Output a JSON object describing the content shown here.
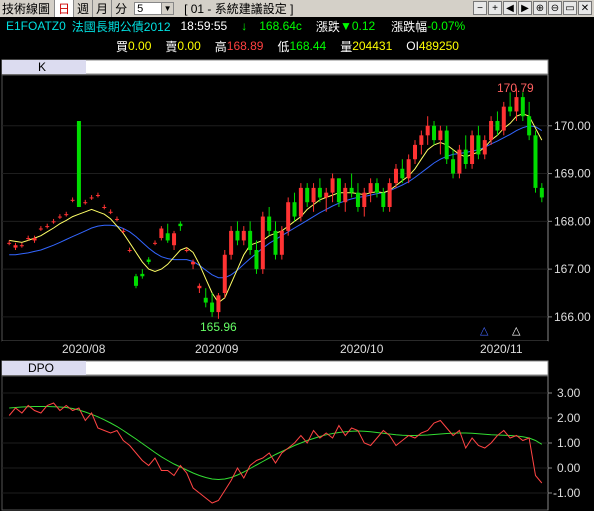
{
  "toolbar": {
    "title": "技術線圖",
    "periods": [
      "日",
      "週",
      "月",
      "分"
    ],
    "active_period": "日",
    "minute_value": "5",
    "setting_label": "[ 01 - 系統建議設定 ]",
    "tool_icons": [
      "minus-icon",
      "plus-icon",
      "left-arrow-icon",
      "right-arrow-icon",
      "zoom-in-icon",
      "zoom-out-icon",
      "window-icon",
      "close-icon"
    ],
    "tool_glyphs": [
      "−",
      "+",
      "◀",
      "▶",
      "⊕",
      "⊖",
      "▭",
      "✕"
    ]
  },
  "quote": {
    "symbol": "E1FOATZ0",
    "name": "法國長期公債2012",
    "time": "18:59:55",
    "arrow": "↓",
    "last": "168.64c",
    "change_label": "漲跌",
    "change": "▼0.12",
    "change_pct_label": "漲跌幅",
    "change_pct": "-0.07%",
    "bid_label": "買",
    "bid": "0.00",
    "ask_label": "賣",
    "ask": "0.00",
    "high_label": "高",
    "high": "168.89",
    "low_label": "低",
    "low": "168.44",
    "volume_label": "量",
    "volume": "204431",
    "oi_label": "OI",
    "oi": "489250"
  },
  "colors": {
    "up": "#ff3333",
    "down": "#00dd00",
    "ma_short": "#ffff66",
    "ma_long": "#3366ff",
    "dpo": "#ff4444",
    "dpo_signal": "#33dd33"
  },
  "price_panel": {
    "label": "K",
    "max_label": "170.79",
    "min_label": "165.96",
    "date_labels": [
      "2020/08",
      "2020/09",
      "2020/10",
      "2020/11"
    ],
    "markers": [
      "△",
      "△"
    ]
  },
  "dpo_panel": {
    "label": "DPO"
  },
  "chart_data": [
    {
      "type": "candlestick",
      "title": "K",
      "x_labels": [
        "2020/08",
        "2020/09",
        "2020/10",
        "2020/11"
      ],
      "y_ticks": [
        166.0,
        167.0,
        168.0,
        169.0,
        170.0
      ],
      "ylim": [
        165.6,
        171.0
      ],
      "annotations": [
        {
          "text": "170.79",
          "kind": "high"
        },
        {
          "text": "165.96",
          "kind": "low"
        }
      ],
      "series": [
        {
          "name": "candles",
          "ohlc": [
            [
              167.55,
              167.6,
              167.5,
              167.55
            ],
            [
              167.45,
              167.55,
              167.4,
              167.5
            ],
            [
              167.5,
              167.55,
              167.45,
              167.5
            ],
            [
              167.65,
              167.7,
              167.6,
              167.65
            ],
            [
              167.6,
              167.7,
              167.55,
              167.65
            ],
            [
              167.85,
              167.9,
              167.8,
              167.85
            ],
            [
              167.9,
              167.95,
              167.85,
              167.9
            ],
            [
              168.0,
              168.05,
              167.95,
              168.0
            ],
            [
              168.1,
              168.15,
              168.05,
              168.1
            ],
            [
              168.15,
              168.2,
              168.1,
              168.15
            ],
            [
              168.45,
              168.5,
              168.4,
              168.45
            ],
            [
              170.1,
              170.1,
              168.3,
              168.3
            ],
            [
              168.4,
              168.45,
              168.35,
              168.4
            ],
            [
              168.5,
              168.55,
              168.45,
              168.5
            ],
            [
              168.55,
              168.6,
              168.5,
              168.55
            ],
            [
              168.3,
              168.35,
              168.25,
              168.3
            ],
            [
              168.2,
              168.25,
              168.15,
              168.2
            ],
            [
              168.05,
              168.1,
              168.0,
              168.05
            ],
            [
              167.8,
              167.85,
              167.75,
              167.8
            ],
            [
              167.4,
              167.45,
              167.35,
              167.4
            ],
            [
              166.85,
              166.9,
              166.6,
              166.65
            ],
            [
              166.9,
              167.0,
              166.8,
              166.85
            ],
            [
              167.2,
              167.25,
              167.1,
              167.15
            ],
            [
              167.55,
              167.6,
              167.5,
              167.55
            ],
            [
              167.65,
              167.9,
              167.6,
              167.85
            ],
            [
              167.75,
              167.95,
              167.55,
              167.6
            ],
            [
              167.5,
              167.8,
              167.4,
              167.75
            ],
            [
              167.95,
              168.0,
              167.8,
              167.9
            ],
            [
              167.4,
              167.45,
              167.35,
              167.4
            ],
            [
              167.1,
              167.2,
              167.0,
              167.15
            ],
            [
              166.6,
              166.7,
              166.5,
              166.65
            ],
            [
              166.4,
              166.6,
              166.2,
              166.3
            ],
            [
              166.3,
              166.5,
              166.0,
              166.1
            ],
            [
              166.1,
              166.5,
              165.96,
              166.45
            ],
            [
              166.5,
              167.4,
              166.4,
              167.3
            ],
            [
              167.3,
              167.9,
              167.2,
              167.8
            ],
            [
              167.8,
              168.0,
              167.5,
              167.6
            ],
            [
              167.6,
              167.9,
              167.5,
              167.8
            ],
            [
              167.8,
              168.0,
              167.3,
              167.4
            ],
            [
              167.4,
              167.6,
              166.9,
              167.0
            ],
            [
              167.0,
              168.2,
              166.9,
              168.1
            ],
            [
              168.1,
              168.3,
              167.7,
              167.8
            ],
            [
              167.8,
              168.0,
              167.2,
              167.3
            ],
            [
              167.3,
              167.9,
              167.2,
              167.8
            ],
            [
              167.8,
              168.5,
              167.7,
              168.4
            ],
            [
              168.4,
              168.6,
              168.0,
              168.1
            ],
            [
              168.1,
              168.8,
              168.0,
              168.7
            ],
            [
              168.7,
              168.8,
              168.3,
              168.4
            ],
            [
              168.4,
              168.8,
              168.2,
              168.7
            ],
            [
              168.7,
              168.9,
              168.4,
              168.5
            ],
            [
              168.5,
              168.7,
              168.2,
              168.6
            ],
            [
              168.6,
              169.0,
              168.4,
              168.9
            ],
            [
              168.9,
              168.9,
              168.3,
              168.4
            ],
            [
              168.4,
              168.8,
              168.2,
              168.7
            ],
            [
              168.7,
              169.0,
              168.5,
              168.6
            ],
            [
              168.6,
              168.8,
              168.2,
              168.3
            ],
            [
              168.3,
              168.7,
              168.1,
              168.6
            ],
            [
              168.6,
              168.9,
              168.4,
              168.8
            ],
            [
              168.8,
              168.9,
              168.5,
              168.6
            ],
            [
              168.6,
              168.7,
              168.2,
              168.3
            ],
            [
              168.3,
              168.9,
              168.2,
              168.8
            ],
            [
              168.8,
              169.2,
              168.7,
              169.1
            ],
            [
              169.1,
              169.3,
              168.8,
              168.9
            ],
            [
              168.9,
              169.4,
              168.8,
              169.3
            ],
            [
              169.3,
              169.7,
              169.2,
              169.6
            ],
            [
              169.6,
              169.9,
              169.4,
              169.8
            ],
            [
              169.8,
              170.2,
              169.6,
              170.0
            ],
            [
              170.0,
              170.1,
              169.6,
              169.7
            ],
            [
              169.7,
              170.0,
              169.4,
              169.9
            ],
            [
              169.9,
              170.0,
              169.2,
              169.3
            ],
            [
              169.3,
              169.5,
              168.9,
              169.0
            ],
            [
              169.0,
              169.6,
              168.9,
              169.5
            ],
            [
              169.5,
              169.8,
              169.1,
              169.2
            ],
            [
              169.2,
              169.9,
              169.1,
              169.8
            ],
            [
              169.8,
              170.0,
              169.3,
              169.4
            ],
            [
              169.4,
              169.8,
              169.3,
              169.7
            ],
            [
              169.7,
              170.2,
              169.6,
              170.1
            ],
            [
              170.1,
              170.3,
              169.8,
              169.9
            ],
            [
              169.9,
              170.5,
              169.8,
              170.4
            ],
            [
              170.4,
              170.7,
              170.2,
              170.3
            ],
            [
              170.3,
              170.79,
              170.1,
              170.6
            ],
            [
              170.6,
              170.7,
              170.1,
              170.2
            ],
            [
              170.2,
              170.5,
              169.7,
              169.8
            ],
            [
              169.8,
              169.9,
              168.6,
              168.7
            ],
            [
              168.7,
              168.8,
              168.4,
              168.5
            ]
          ]
        },
        {
          "name": "MA short",
          "values": [
            167.6,
            167.58,
            167.56,
            167.6,
            167.65,
            167.7,
            167.78,
            167.86,
            167.95,
            168.02,
            168.1,
            168.15,
            168.2,
            168.25,
            168.2,
            168.15,
            168.05,
            167.9,
            167.75,
            167.55,
            167.35,
            167.15,
            167.0,
            166.95,
            167.0,
            167.1,
            167.25,
            167.4,
            167.45,
            167.35,
            167.1,
            166.8,
            166.5,
            166.3,
            166.4,
            166.7,
            167.0,
            167.3,
            167.5,
            167.55,
            167.6,
            167.7,
            167.75,
            167.8,
            167.9,
            168.0,
            168.1,
            168.25,
            168.35,
            168.45,
            168.5,
            168.55,
            168.6,
            168.6,
            168.6,
            168.58,
            168.56,
            168.6,
            168.62,
            168.6,
            168.65,
            168.75,
            168.85,
            168.95,
            169.1,
            169.3,
            169.5,
            169.6,
            169.65,
            169.6,
            169.5,
            169.4,
            169.35,
            169.4,
            169.45,
            169.55,
            169.7,
            169.8,
            169.95,
            170.05,
            170.2,
            170.25,
            170.2,
            169.95,
            169.7
          ]
        },
        {
          "name": "MA long",
          "values": [
            167.3,
            167.3,
            167.32,
            167.34,
            167.37,
            167.4,
            167.45,
            167.5,
            167.56,
            167.62,
            167.68,
            167.74,
            167.8,
            167.86,
            167.9,
            167.92,
            167.92,
            167.9,
            167.85,
            167.78,
            167.68,
            167.56,
            167.44,
            167.34,
            167.26,
            167.22,
            167.2,
            167.2,
            167.2,
            167.16,
            167.08,
            166.98,
            166.88,
            166.82,
            166.82,
            166.88,
            166.98,
            167.1,
            167.22,
            167.33,
            167.44,
            167.54,
            167.62,
            167.7,
            167.78,
            167.86,
            167.94,
            168.02,
            168.1,
            168.18,
            168.25,
            168.32,
            168.38,
            168.43,
            168.47,
            168.5,
            168.52,
            168.55,
            168.58,
            168.6,
            168.64,
            168.7,
            168.76,
            168.83,
            168.92,
            169.02,
            169.12,
            169.22,
            169.3,
            169.36,
            169.4,
            169.42,
            169.44,
            169.47,
            169.5,
            169.55,
            169.62,
            169.68,
            169.75,
            169.82,
            169.9,
            169.96,
            170.0,
            169.98,
            169.9
          ]
        }
      ]
    },
    {
      "type": "line",
      "title": "DPO",
      "y_ticks": [
        -1.0,
        0.0,
        1.0,
        2.0,
        3.0
      ],
      "ylim": [
        -1.6,
        3.6
      ],
      "series": [
        {
          "name": "DPO",
          "values": [
            2.1,
            2.4,
            2.2,
            2.5,
            2.3,
            2.2,
            2.5,
            2.6,
            2.3,
            2.5,
            2.3,
            2.4,
            1.9,
            2.2,
            1.6,
            1.5,
            1.4,
            1.5,
            1.1,
            0.9,
            0.6,
            0.3,
            0.1,
            0.4,
            -0.1,
            -0.1,
            -0.3,
            0.1,
            -0.2,
            -0.8,
            -1.0,
            -1.2,
            -1.4,
            -1.3,
            -0.9,
            -0.5,
            0.0,
            -0.4,
            0.1,
            0.3,
            0.4,
            0.6,
            0.2,
            0.6,
            0.8,
            1.0,
            1.3,
            1.0,
            1.5,
            1.2,
            1.4,
            1.2,
            1.7,
            1.3,
            1.6,
            1.5,
            1.0,
            0.9,
            1.2,
            1.5,
            1.3,
            0.9,
            1.1,
            1.3,
            1.2,
            1.4,
            1.5,
            1.8,
            1.9,
            1.6,
            1.3,
            1.5,
            0.8,
            1.2,
            0.9,
            0.8,
            1.0,
            1.3,
            1.5,
            1.2,
            1.3,
            1.1,
            1.2,
            -0.3,
            -0.6
          ]
        },
        {
          "name": "signal",
          "values": [
            2.4,
            2.42,
            2.44,
            2.45,
            2.46,
            2.46,
            2.46,
            2.45,
            2.44,
            2.42,
            2.38,
            2.32,
            2.24,
            2.15,
            2.05,
            1.93,
            1.8,
            1.66,
            1.5,
            1.33,
            1.16,
            0.98,
            0.8,
            0.62,
            0.45,
            0.3,
            0.16,
            0.04,
            -0.08,
            -0.2,
            -0.3,
            -0.38,
            -0.44,
            -0.46,
            -0.44,
            -0.38,
            -0.28,
            -0.16,
            -0.02,
            0.12,
            0.26,
            0.4,
            0.54,
            0.66,
            0.78,
            0.9,
            1.0,
            1.1,
            1.18,
            1.26,
            1.33,
            1.38,
            1.42,
            1.45,
            1.47,
            1.48,
            1.47,
            1.45,
            1.42,
            1.39,
            1.36,
            1.33,
            1.31,
            1.3,
            1.3,
            1.31,
            1.32,
            1.34,
            1.36,
            1.38,
            1.39,
            1.4,
            1.4,
            1.39,
            1.37,
            1.35,
            1.33,
            1.32,
            1.31,
            1.3,
            1.28,
            1.25,
            1.2,
            1.1,
            0.95
          ]
        }
      ]
    }
  ]
}
